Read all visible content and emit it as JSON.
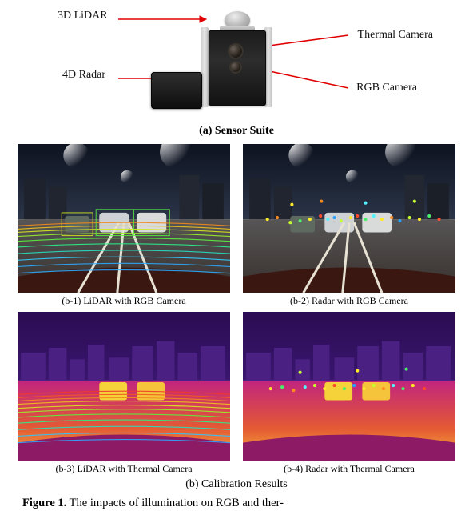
{
  "sensor_suite": {
    "title": "(a) Sensor Suite",
    "labels": {
      "lidar3d": "3D LiDAR",
      "radar4d": "4D Radar",
      "thermal": "Thermal Camera",
      "rgb": "RGB Camera"
    }
  },
  "calibration": {
    "title": "(b) Calibration Results",
    "panels": {
      "b1": "(b-1) LiDAR with RGB Camera",
      "b2": "(b-2) Radar with RGB Camera",
      "b3": "(b-3) LiDAR with Thermal Camera",
      "b4": "(b-4) Radar with Thermal Camera"
    }
  },
  "figure_caption": {
    "prefix": "Figure  1.",
    "text": "  The  impacts  of  illumination  on  RGB  and  ther-"
  }
}
